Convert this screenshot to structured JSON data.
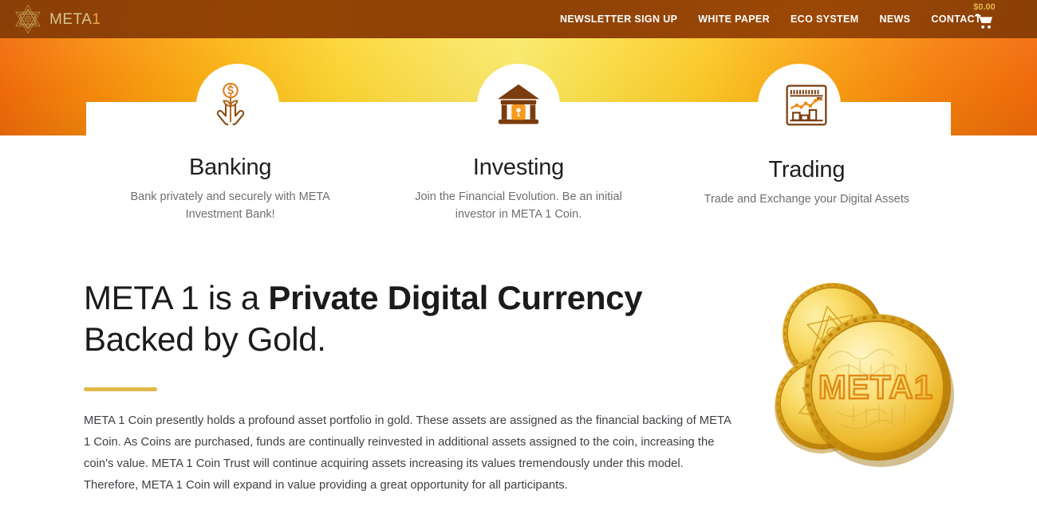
{
  "brand": {
    "logo_icon": "hexagram-star-logo-icon",
    "name_main": "META",
    "name_accent": "1"
  },
  "header": {
    "nav_items": [
      {
        "label": "NEWSLETTER SIGN UP",
        "name": "nav-newsletter-sign-up"
      },
      {
        "label": "WHITE PAPER",
        "name": "nav-white-paper"
      },
      {
        "label": "ECO SYSTEM",
        "name": "nav-eco-system"
      },
      {
        "label": "NEWS",
        "name": "nav-news"
      },
      {
        "label": "CONTACT",
        "name": "nav-contact"
      }
    ],
    "cart": {
      "amount": "$0.00",
      "icon": "shopping-cart-icon"
    },
    "colors": {
      "bar_background": "#8e4206",
      "nav_text": "#ffffff",
      "cart_amount": "#e2b84a",
      "logo_text": "#d8c48a",
      "logo_accent": "#e8a33a"
    }
  },
  "band": {
    "gradient_edge": "#f26b0a",
    "gradient_center": "#fae969"
  },
  "features": [
    {
      "icon": "hands-holding-money-plant-icon",
      "title": "Banking",
      "description": "Bank privately and securely with META Investment Bank!"
    },
    {
      "icon": "bank-building-vault-lock-icon",
      "title": "Investing",
      "description": "Join the Financial Evolution. Be an initial investor in META 1 Coin."
    },
    {
      "icon": "trading-chart-window-icon",
      "title": "Trading",
      "description": "Trade and Exchange your Digital Assets"
    }
  ],
  "hero": {
    "headline_part1": "META 1 is a ",
    "headline_bold": "Private Digital Currency",
    "headline_part2": " Backed by Gold.",
    "divider_color": "#e0b84a",
    "paragraph": "META 1 Coin presently holds a profound asset portfolio in gold. These assets are assigned as the financial backing of META 1 Coin. As Coins are purchased, funds are continually reinvested in additional assets assigned to the coin, increasing the coin's value. META 1 Coin Trust will continue acquiring assets increasing its values tremendously under this model. Therefore, META 1 Coin will expand in value providing a great opportunity for all participants.",
    "coins_image": "three-gold-meta1-coins-image",
    "coin_face_text": "META1"
  }
}
